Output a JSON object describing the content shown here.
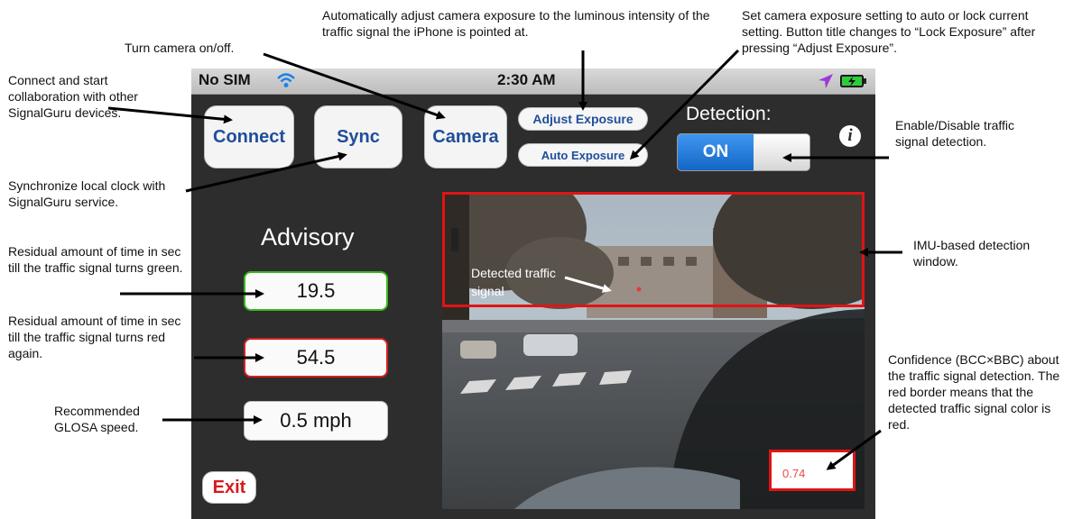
{
  "annotations": {
    "exposure_auto": "Automatically adjust camera exposure to the luminous intensity of the traffic signal the iPhone is pointed at.",
    "exposure_lock": "Set camera exposure setting to auto or lock current setting. Button title changes to “Lock Exposure” after pressing “Adjust Exposure”.",
    "camera_toggle": "Turn camera on/off.",
    "connect": "Connect and start collaboration with other SignalGuru devices.",
    "sync": "Synchronize local clock with SignalGuru service.",
    "detection_toggle": "Enable/Disable traffic signal detection.",
    "imu_window": "IMU-based detection window.",
    "green_time": "Residual amount of time in sec till the traffic signal turns green.",
    "red_time": "Residual amount of time in sec till the traffic signal turns red again.",
    "speed": "Recommended GLOSA speed.",
    "confidence": "Confidence (BCC×BBC) about the traffic signal detection. The red border means that the detected traffic signal color is red.",
    "detected_signal": "Detected traffic signal"
  },
  "statusbar": {
    "carrier": "No SIM",
    "time": "2:30 AM",
    "wifi_icon": "wifi-icon",
    "location_icon": "location-arrow-icon",
    "battery_icon": "battery-charging-icon"
  },
  "toolbar": {
    "connect_label": "Connect",
    "sync_label": "Sync",
    "camera_label": "Camera",
    "adjust_exposure_label": "Adjust Exposure",
    "auto_exposure_label": "Auto Exposure",
    "detection_label": "Detection:",
    "detection_state": "ON",
    "info_label": "i"
  },
  "advisory": {
    "title": "Advisory",
    "green_time": "19.5",
    "red_time": "54.5",
    "speed": "0.5 mph",
    "exit_label": "Exit"
  },
  "camera": {
    "confidence": "0.74"
  },
  "colors": {
    "accent_blue": "#1f4e9a",
    "toggle_on": "#1d76d8",
    "green_border": "#39b81c",
    "red_border": "#d42020",
    "exit_red": "#d8191c"
  }
}
